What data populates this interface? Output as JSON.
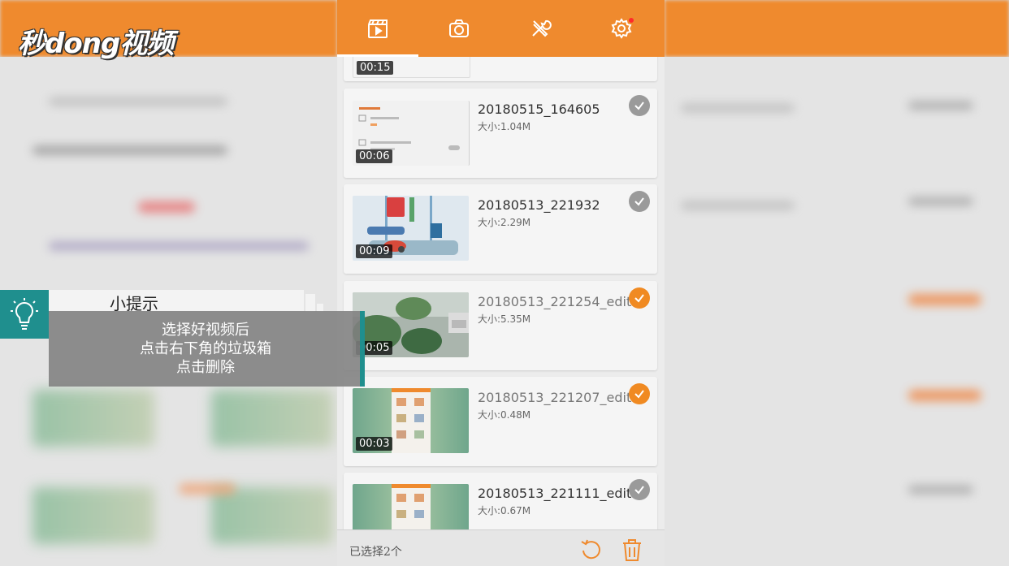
{
  "logo": {
    "text": "秒d🔵ng视频",
    "display": "秒dong视频"
  },
  "tabs": [
    {
      "id": "video",
      "icon": "video-clapper-icon",
      "active": true
    },
    {
      "id": "camera",
      "icon": "camera-icon",
      "active": false
    },
    {
      "id": "tools",
      "icon": "tools-icon",
      "active": false
    },
    {
      "id": "settings",
      "icon": "gear-icon",
      "active": false,
      "notification": true
    }
  ],
  "items": [
    {
      "name": "",
      "size": "",
      "duration": "00:15",
      "checked": false
    },
    {
      "name": "20180515_164605",
      "size": "大小:1.04M",
      "duration": "00:06",
      "checked": false
    },
    {
      "name": "20180513_221932",
      "size": "大小:2.29M",
      "duration": "00:09",
      "checked": false
    },
    {
      "name": "20180513_221254_edit...",
      "size": "大小:5.35M",
      "duration": "00:05",
      "checked": true
    },
    {
      "name": "20180513_221207_edit...",
      "size": "大小:0.48M",
      "duration": "00:03",
      "checked": true
    },
    {
      "name": "20180513_221111_edit...",
      "size": "大小:0.67M",
      "duration": "",
      "checked": false
    }
  ],
  "bottom": {
    "selected_text": "已选择2个",
    "restore_icon": "undo-icon",
    "delete_icon": "trash-icon"
  },
  "tip": {
    "title": "小提示",
    "lines": [
      "选择好视频后",
      "点击右下角的垃圾箱",
      "点击删除"
    ]
  },
  "colors": {
    "accent": "#ef8a2e",
    "check_on": "#f08a22",
    "check_off": "#9a9a9a",
    "tip_teal": "#1f8f8e"
  }
}
